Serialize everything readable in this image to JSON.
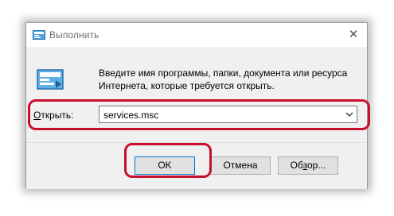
{
  "window": {
    "title": "Выполнить",
    "close_glyph": "✕",
    "icon": "run-icon"
  },
  "description": {
    "line1": "Введите имя программы, папки, документа или ресурса",
    "line2": "Интернета, которые требуется открыть."
  },
  "open_field": {
    "label_accel": "О",
    "label_rest": "ткрыть:",
    "value": "services.msc"
  },
  "buttons": {
    "ok": "OK",
    "cancel": "Отмена",
    "browse_pre": "Об",
    "browse_accel": "з",
    "browse_post": "ор..."
  },
  "colors": {
    "highlight": "#c8102e",
    "focus_border": "#0078d7",
    "dialog_bg": "#f0f0f0"
  }
}
